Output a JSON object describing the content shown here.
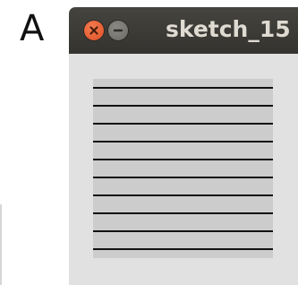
{
  "panel_label": "A",
  "window": {
    "title": "sketch_15",
    "controls": [
      {
        "name": "close",
        "icon": "close-icon",
        "color": "#e9562a"
      },
      {
        "name": "minimize",
        "icon": "minimize-icon",
        "color": "#7b7a74"
      }
    ]
  },
  "canvas": {
    "background": "#cccccc",
    "line_color": "#111111",
    "line_count": 11
  }
}
